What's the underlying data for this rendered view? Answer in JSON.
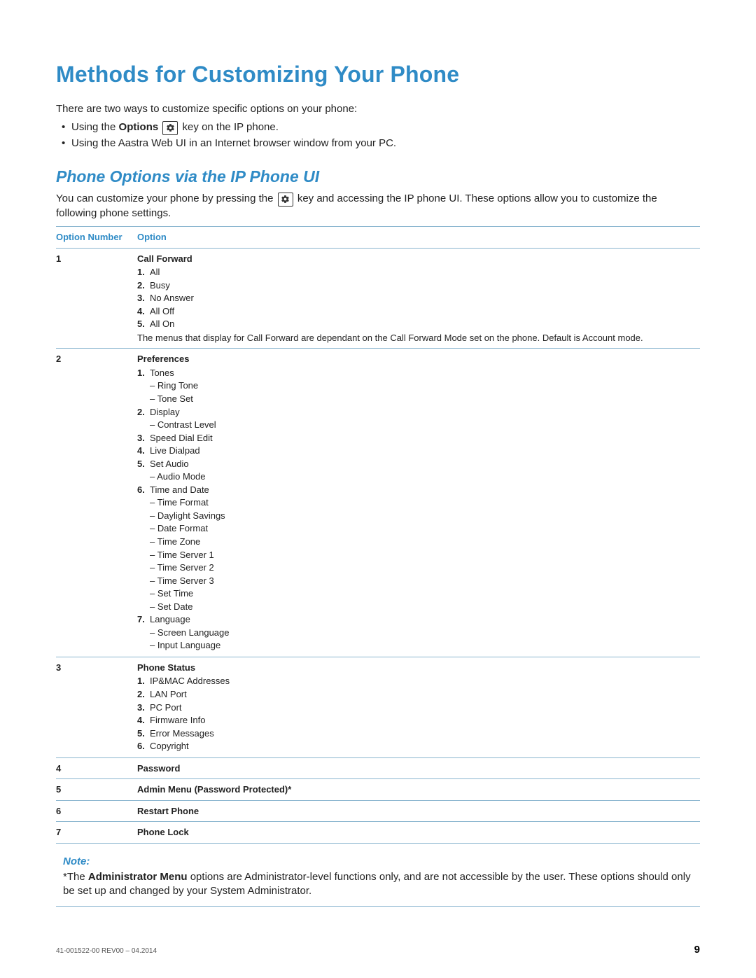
{
  "title": "Methods for Customizing Your Phone",
  "intro": "There are two ways to customize specific options on your phone:",
  "bullets": [
    {
      "pre": "Using the ",
      "bold": "Options",
      "post1": " ",
      "gear": true,
      "post2": " key on the IP phone."
    },
    {
      "pre": "Using the Aastra Web UI in an Internet browser window from your PC.",
      "bold": "",
      "post1": "",
      "gear": false,
      "post2": ""
    }
  ],
  "section_title": "Phone Options via the IP Phone UI",
  "section_intro_pre": "You can customize your phone by pressing the ",
  "section_intro_post": " key and accessing the IP phone UI. These options allow you to customize the following phone settings.",
  "table": {
    "headers": [
      "Option Number",
      "Option"
    ],
    "rows": [
      {
        "num": "1",
        "title": "Call Forward",
        "items": [
          {
            "label": "All"
          },
          {
            "label": "Busy"
          },
          {
            "label": "No Answer"
          },
          {
            "label": "All Off"
          },
          {
            "label": "All On"
          }
        ],
        "note": "The menus that display for Call Forward are dependant on the Call Forward Mode set on the phone. Default is Account mode."
      },
      {
        "num": "2",
        "title": "Preferences",
        "items": [
          {
            "label": "Tones",
            "sub": [
              "Ring Tone",
              "Tone Set"
            ]
          },
          {
            "label": "Display",
            "sub": [
              "Contrast Level"
            ]
          },
          {
            "label": "Speed Dial Edit"
          },
          {
            "label": "Live Dialpad"
          },
          {
            "label": "Set Audio",
            "sub": [
              "Audio Mode"
            ]
          },
          {
            "label": "Time and Date",
            "sub": [
              "Time Format",
              "Daylight Savings",
              "Date Format",
              "Time Zone",
              "Time Server 1",
              "Time Server 2",
              "Time Server 3",
              "Set Time",
              "Set Date"
            ]
          },
          {
            "label": "Language",
            "sub": [
              "Screen Language",
              "Input Language"
            ]
          }
        ]
      },
      {
        "num": "3",
        "title": "Phone Status",
        "items": [
          {
            "label": "IP&MAC Addresses"
          },
          {
            "label": "LAN Port"
          },
          {
            "label": "PC Port"
          },
          {
            "label": "Firmware Info"
          },
          {
            "label": "Error Messages"
          },
          {
            "label": "Copyright"
          }
        ]
      },
      {
        "num": "4",
        "title": "Password"
      },
      {
        "num": "5",
        "title": "Admin Menu (Password Protected)*"
      },
      {
        "num": "6",
        "title": "Restart Phone"
      },
      {
        "num": "7",
        "title": "Phone Lock"
      }
    ]
  },
  "note": {
    "heading": "Note:",
    "pre": "*The ",
    "bold": "Administrator Menu",
    "post": " options are Administrator-level functions only, and are not accessible by the user. These options should only be set up and changed by your System Administrator."
  },
  "footer": {
    "rev": "41-001522-00 REV00 – 04.2014",
    "page": "9"
  }
}
